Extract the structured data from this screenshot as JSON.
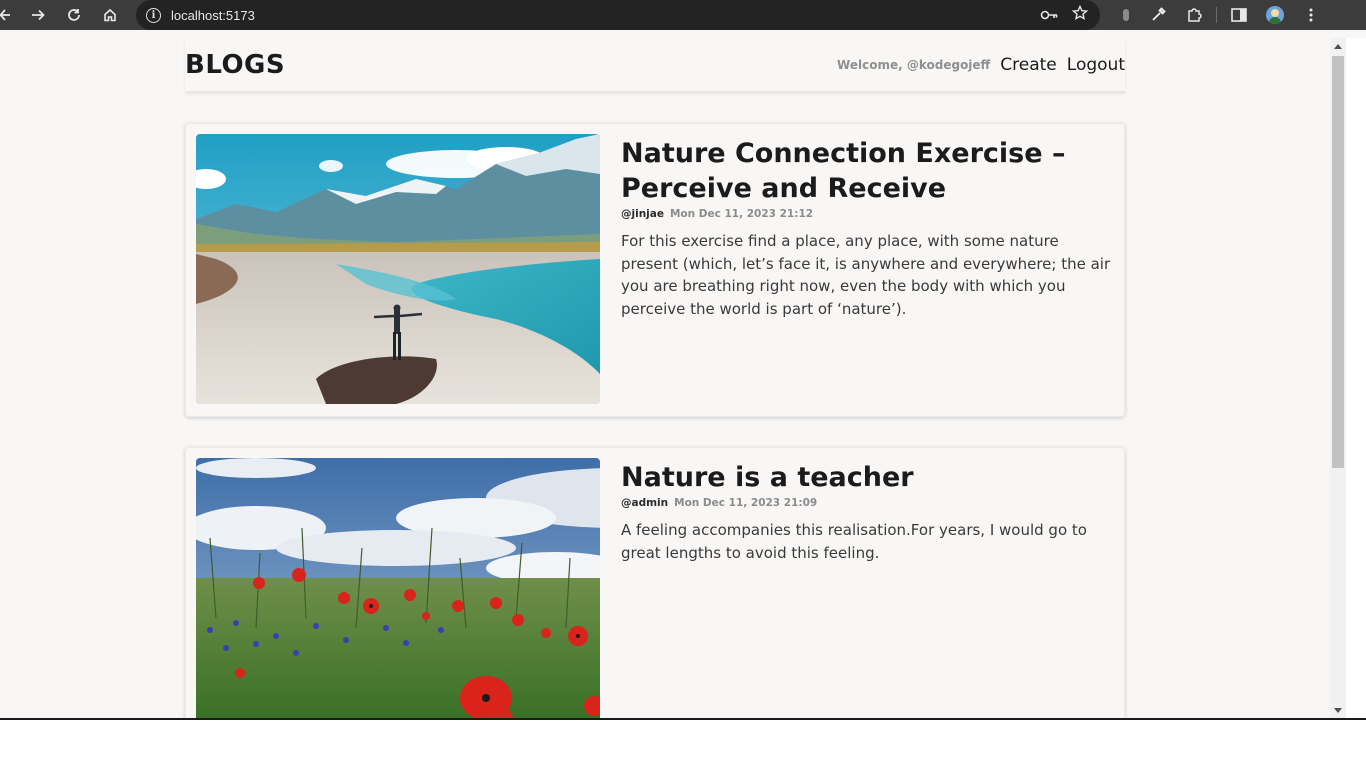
{
  "browser": {
    "url": "localhost:5173",
    "icons": [
      "back-icon",
      "forward-icon",
      "reload-icon",
      "home-icon",
      "site-info-icon",
      "key-icon",
      "star-icon",
      "extension-icon",
      "eyedropper-icon",
      "puzzle-icon",
      "side-panel-icon",
      "profile-icon",
      "menu-icon"
    ]
  },
  "header": {
    "brand": "BLOGS",
    "welcome": "Welcome, @kodegojeff",
    "create_label": "Create",
    "logout_label": "Logout"
  },
  "posts": [
    {
      "title": "Nature Connection Exercise – Perceive and Receive",
      "author": "@jinjae",
      "date": "Mon Dec 11, 2023 21:12",
      "excerpt": "For this exercise find a place, any place, with some nature present (which, let’s face it, is anywhere and everywhere; the air you are breathing right now, even the body with which you perceive the world is part of ‘nature’)."
    },
    {
      "title": "Nature is a teacher",
      "author": "@admin",
      "date": "Mon Dec 11, 2023 21:09",
      "excerpt": "A feeling accompanies this realisation.For years, I would go to great lengths to avoid this feeling."
    }
  ],
  "colors": {
    "page_bg": "#f8f7f6",
    "text": "#1b1b1b",
    "muted": "#8b8b8b",
    "chrome_bg": "#3c3c3c"
  }
}
